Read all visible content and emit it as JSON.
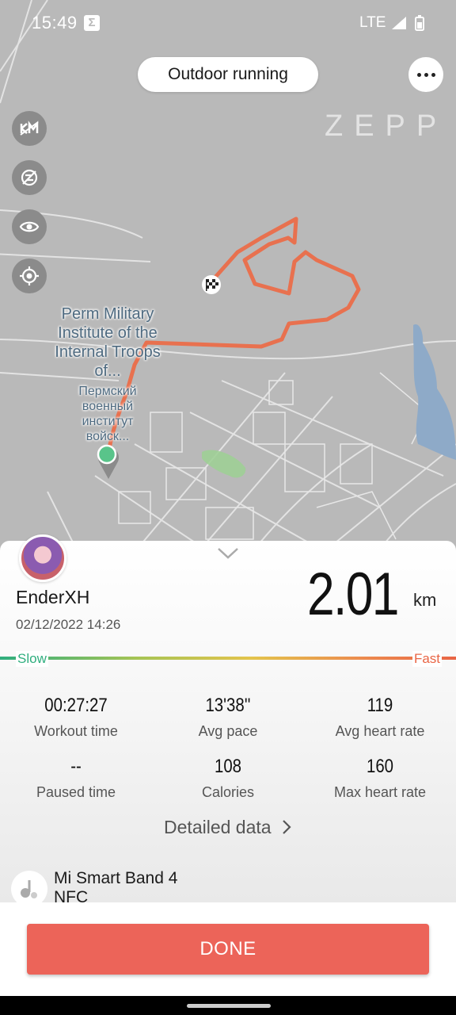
{
  "status_bar": {
    "time": "15:49",
    "network": "LTE"
  },
  "header": {
    "title": "Outdoor running",
    "brand": "ZEPP"
  },
  "map": {
    "label_en": "Perm Military Institute of the Internal Troops of...",
    "label_ru": "Пермский военный институт войск...",
    "tools": [
      "km-toggle-icon",
      "map-style-icon",
      "visibility-icon",
      "locate-icon"
    ],
    "route_color": "#e8714f"
  },
  "summary": {
    "user_name": "EnderXH",
    "datetime": "02/12/2022 14:26",
    "distance": "2.01",
    "distance_unit": "km",
    "pace_slow": "Slow",
    "pace_fast": "Fast"
  },
  "stats": [
    {
      "value": "00:27:27",
      "label": "Workout time"
    },
    {
      "value": "13'38''",
      "label": "Avg pace"
    },
    {
      "value": "119",
      "label": "Avg heart rate"
    },
    {
      "value": "--",
      "label": "Paused time"
    },
    {
      "value": "108",
      "label": "Calories"
    },
    {
      "value": "160",
      "label": "Max heart rate"
    }
  ],
  "detailed_link": "Detailed data",
  "device": {
    "name_line1": "Mi Smart Band 4",
    "name_line2": "NFC"
  },
  "done_label": "DONE",
  "colors": {
    "accent": "#ec6459",
    "slow": "#2fae7e",
    "fast": "#e96545"
  }
}
